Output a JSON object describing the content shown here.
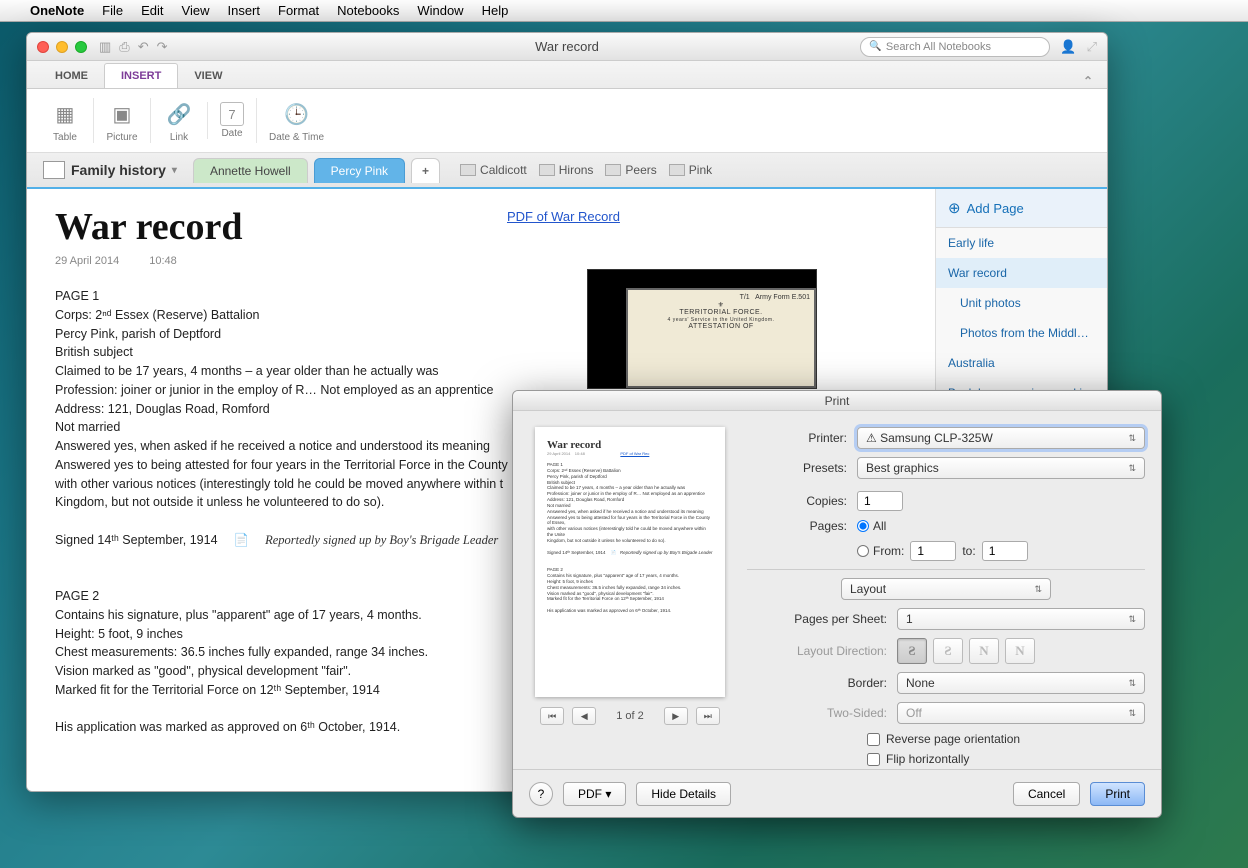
{
  "menubar": {
    "appname": "OneNote",
    "items": [
      "File",
      "Edit",
      "View",
      "Insert",
      "Format",
      "Notebooks",
      "Window",
      "Help"
    ]
  },
  "window": {
    "title": "War record",
    "search_placeholder": "Search All Notebooks"
  },
  "ribbon_tabs": [
    "HOME",
    "INSERT",
    "VIEW"
  ],
  "ribbon_tabs_active": "INSERT",
  "ribbon_groups": [
    {
      "label": "Table",
      "icon": "▦"
    },
    {
      "label": "Picture",
      "icon": "▣"
    },
    {
      "label": "Link",
      "icon": "🔗"
    },
    {
      "label": "Date",
      "icon": "7"
    },
    {
      "label": "Date & Time",
      "icon": "🕒"
    }
  ],
  "notebook": {
    "name": "Family history"
  },
  "section_tabs": [
    {
      "label": "Annette Howell",
      "class": "green"
    },
    {
      "label": "Percy Pink",
      "class": "blue"
    }
  ],
  "quick_tags": [
    "Caldicott",
    "Hirons",
    "Peers",
    "Pink"
  ],
  "page": {
    "title": "War record",
    "date": "29 April 2014",
    "time": "10:48",
    "pdf_link": "PDF of War Record",
    "body_lines_1": [
      "PAGE 1",
      "Corps: 2ⁿᵈ Essex (Reserve) Battalion",
      "Percy Pink, parish of Deptford",
      "British subject",
      "Claimed to be 17 years, 4 months – a year older than he actually was",
      "Profession: joiner or junior in the employ of R… Not employed as an apprentice",
      "Address: 121, Douglas Road, Romford",
      "Not married",
      "Answered yes, when asked if he received a notice and understood its meaning",
      "Answered yes to being attested for four years in the Territorial Force in the County",
      "with other various notices (interestingly told he could be moved anywhere within t",
      "Kingdom, but not outside it unless he volunteered to do so)."
    ],
    "signed_line": "Signed 14ᵗʰ September, 1914",
    "note": "Reportedly signed up by Boy's Brigade Leader",
    "body_lines_2": [
      "PAGE 2",
      "Contains his signature, plus \"apparent\" age of 17 years, 4 months.",
      "Height: 5 foot, 9 inches",
      "Chest measurements: 36.5 inches fully expanded, range 34 inches.",
      "Vision marked as \"good\", physical development \"fair\".",
      "Marked fit for the Territorial Force on 12ᵗʰ September, 1914"
    ],
    "approved_line": "His application was marked as approved on 6ᵗʰ October, 1914."
  },
  "page_list": {
    "add_label": "Add Page",
    "items": [
      {
        "label": "Early life",
        "indent": false,
        "selected": false
      },
      {
        "label": "War record",
        "indent": false,
        "selected": true
      },
      {
        "label": "Unit photos",
        "indent": true,
        "selected": false
      },
      {
        "label": "Photos from the Middle…",
        "indent": true,
        "selected": false
      },
      {
        "label": "Australia",
        "indent": false,
        "selected": false
      },
      {
        "label": "Back home again – worki…",
        "indent": false,
        "selected": false
      }
    ]
  },
  "print": {
    "title": "Print",
    "preview_label": "1 of 2",
    "printer_label": "Printer:",
    "printer_value": "⚠ Samsung CLP-325W",
    "presets_label": "Presets:",
    "presets_value": "Best graphics",
    "copies_label": "Copies:",
    "copies_value": "1",
    "pages_label": "Pages:",
    "pages_all": "All",
    "pages_from_label": "From:",
    "pages_from_value": "1",
    "pages_to_label": "to:",
    "pages_to_value": "1",
    "section_dropdown": "Layout",
    "pps_label": "Pages per Sheet:",
    "pps_value": "1",
    "dir_label": "Layout Direction:",
    "border_label": "Border:",
    "border_value": "None",
    "twosided_label": "Two-Sided:",
    "twosided_value": "Off",
    "reverse_label": "Reverse page orientation",
    "flip_label": "Flip horizontally",
    "help_label": "?",
    "pdf_label": "PDF ▾",
    "hide_label": "Hide Details",
    "cancel_label": "Cancel",
    "print_label": "Print"
  }
}
